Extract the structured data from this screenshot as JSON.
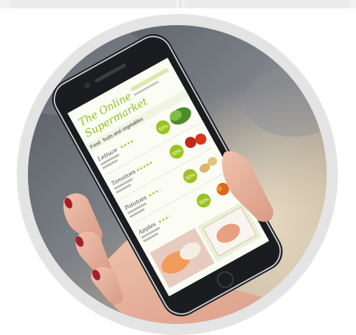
{
  "screen": {
    "title_line1": "The Online",
    "title_line2": "Supermarket",
    "breadcrumb_food": "Food",
    "breadcrumb_category": "fruits and vegetables",
    "badge": "50%",
    "products": [
      {
        "name": "Lettuce"
      },
      {
        "name": "Tomatoes"
      },
      {
        "name": "Potatoes"
      },
      {
        "name": "Apples"
      }
    ]
  },
  "colors": {
    "ring": "#e4e4e4",
    "accent_green": "#9bc31f",
    "screen_bg": "#fbfdf5",
    "phone_body": "#1b1c20"
  }
}
